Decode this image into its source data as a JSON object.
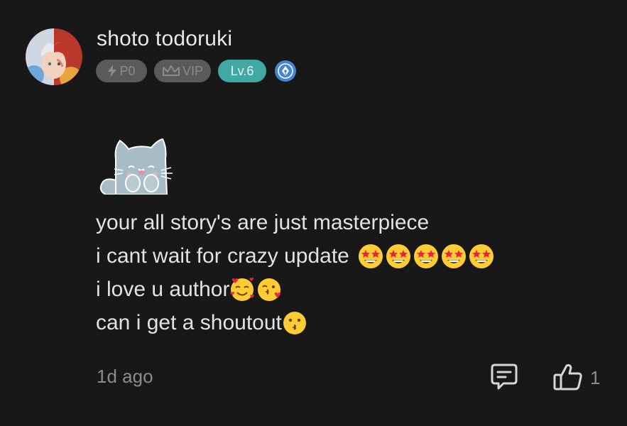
{
  "author": {
    "name": "shoto todoruki",
    "avatar": "anime-character-avatar"
  },
  "badges": {
    "points": "P0",
    "points_icon": "lightning-icon",
    "vip": "VIP",
    "vip_icon": "crown-icon",
    "level": "Lv.6",
    "writer_icon": "pen-nib-icon"
  },
  "sticker": "cat-sticker",
  "comment_lines": [
    {
      "text": "your all story's are just masterpiece",
      "emojis": []
    },
    {
      "text": "i cant wait for crazy update ",
      "emojis": [
        "star-struck",
        "star-struck",
        "star-struck",
        "star-struck",
        "star-struck"
      ]
    },
    {
      "text": "i love u author",
      "emojis": [
        "smiling-face-with-hearts",
        "face-blowing-kiss"
      ]
    },
    {
      "text": "can i get a shoutout",
      "emojis": [
        "kissing-face"
      ]
    }
  ],
  "footer": {
    "time_ago": "1d ago",
    "reply_icon": "comment-reply-icon",
    "like_icon": "thumbs-up-icon",
    "like_count": "1"
  },
  "colors": {
    "background": "#181818",
    "level_badge": "#40a9a4",
    "writer_badge": "#3f86d4",
    "inactive_badge": "#5a5a5a"
  }
}
